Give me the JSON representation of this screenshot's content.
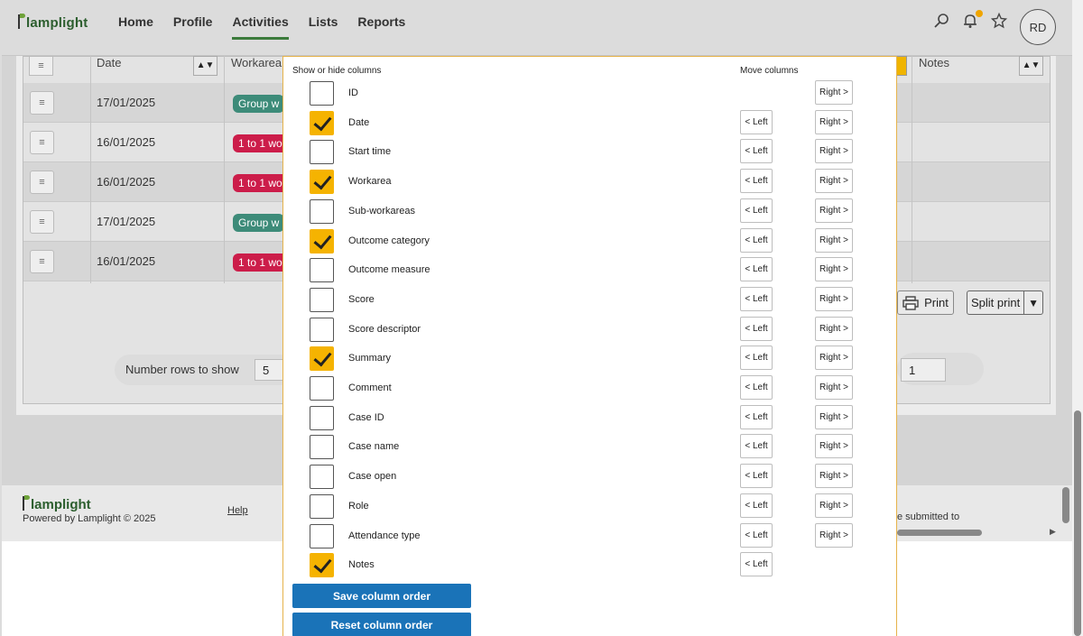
{
  "app": {
    "logo": "lamplight",
    "nav": [
      "Home",
      "Profile",
      "Activities",
      "Lists",
      "Reports"
    ],
    "active_nav": "Activities",
    "avatar_initials": "RD"
  },
  "table": {
    "headers": {
      "date": "Date",
      "workarea": "Workarea",
      "notes": "Notes"
    },
    "rows": [
      {
        "date": "17/01/2025",
        "tag": "Group w",
        "tag_color": "green"
      },
      {
        "date": "16/01/2025",
        "tag": "1 to 1 wo",
        "tag_color": "red"
      },
      {
        "date": "16/01/2025",
        "tag": "1 to 1 wo",
        "tag_color": "red"
      },
      {
        "date": "17/01/2025",
        "tag": "Group w",
        "tag_color": "green"
      },
      {
        "date": "16/01/2025",
        "tag": "1 to 1 wo",
        "tag_color": "red"
      }
    ],
    "print_label": "Print",
    "split_print_label": "Split print",
    "rows_to_show_label": "Number rows to show",
    "rows_to_show_value": "5",
    "page_value": "1"
  },
  "footer": {
    "logo": "lamplight",
    "powered": "Powered by Lamplight © 2025",
    "help": "Help",
    "submitted": "e submitted to"
  },
  "modal": {
    "show_hide_heading": "Show or hide columns",
    "move_heading": "Move columns",
    "left_label": "< Left",
    "right_label": "Right >",
    "columns": [
      {
        "label": "ID",
        "checked": false,
        "left": false,
        "right": true
      },
      {
        "label": "Date",
        "checked": true,
        "left": true,
        "right": true
      },
      {
        "label": "Start time",
        "checked": false,
        "left": true,
        "right": true
      },
      {
        "label": "Workarea",
        "checked": true,
        "left": true,
        "right": true
      },
      {
        "label": "Sub-workareas",
        "checked": false,
        "left": true,
        "right": true
      },
      {
        "label": "Outcome category",
        "checked": true,
        "left": true,
        "right": true
      },
      {
        "label": "Outcome measure",
        "checked": false,
        "left": true,
        "right": true
      },
      {
        "label": "Score",
        "checked": false,
        "left": true,
        "right": true
      },
      {
        "label": "Score descriptor",
        "checked": false,
        "left": true,
        "right": true
      },
      {
        "label": "Summary",
        "checked": true,
        "left": true,
        "right": true
      },
      {
        "label": "Comment",
        "checked": false,
        "left": true,
        "right": true
      },
      {
        "label": "Case ID",
        "checked": false,
        "left": true,
        "right": true
      },
      {
        "label": "Case name",
        "checked": false,
        "left": true,
        "right": true
      },
      {
        "label": "Case open",
        "checked": false,
        "left": true,
        "right": true
      },
      {
        "label": "Role",
        "checked": false,
        "left": true,
        "right": true
      },
      {
        "label": "Attendance type",
        "checked": false,
        "left": true,
        "right": true
      },
      {
        "label": "Notes",
        "checked": true,
        "left": true,
        "right": false
      }
    ],
    "save_label": "Save column order",
    "reset_label": "Reset column order"
  },
  "colors": {
    "accent_blue": "#1a73b8",
    "checkbox_checked": "#f5b301",
    "tag_green": "#3d8b79",
    "tag_red": "#cc1d4a",
    "nav_active": "#3c7b3c"
  }
}
